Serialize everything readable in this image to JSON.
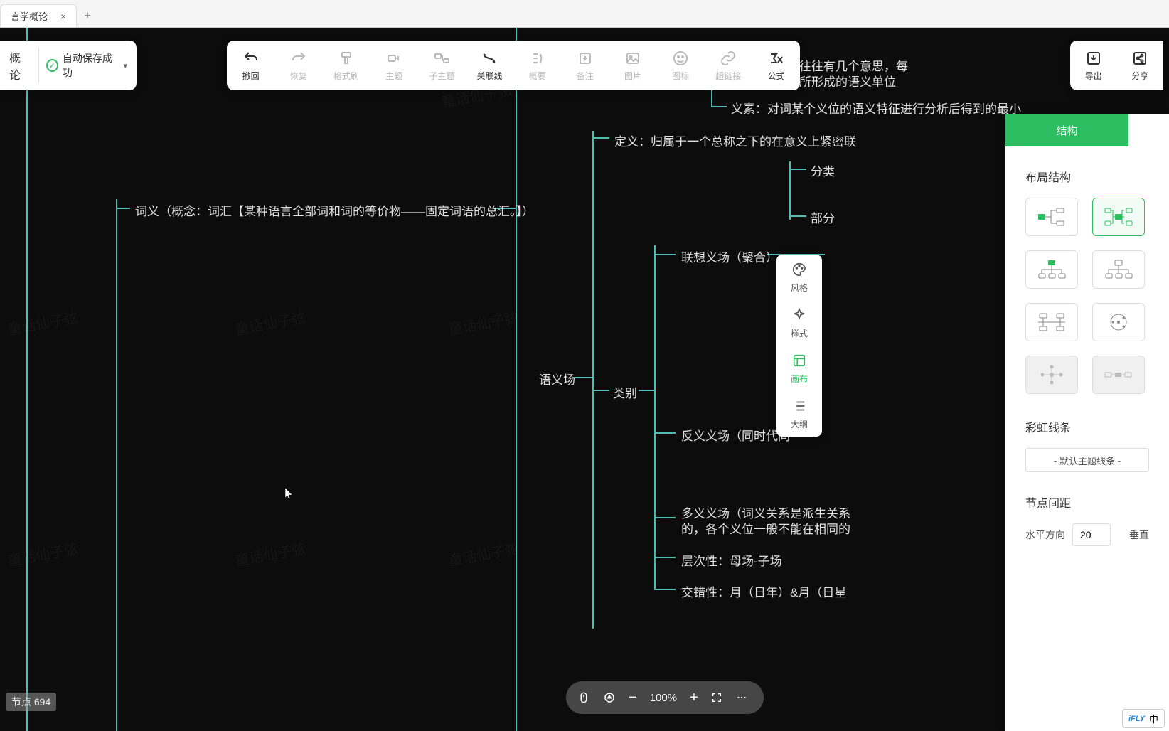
{
  "tab": {
    "title": "言学概论"
  },
  "left_float": {
    "title_cut": "概论",
    "autosave": "自动保存成功"
  },
  "toolbar": [
    {
      "id": "undo",
      "label": "撤回",
      "state": "active"
    },
    {
      "id": "redo",
      "label": "恢复",
      "state": "disabled"
    },
    {
      "id": "format",
      "label": "格式刷",
      "state": "disabled"
    },
    {
      "id": "topic",
      "label": "主题",
      "state": "disabled"
    },
    {
      "id": "subtopic",
      "label": "子主题",
      "state": "disabled"
    },
    {
      "id": "relation",
      "label": "关联线",
      "state": "active"
    },
    {
      "id": "summary",
      "label": "概要",
      "state": "disabled"
    },
    {
      "id": "note",
      "label": "备注",
      "state": "disabled"
    },
    {
      "id": "image",
      "label": "图片",
      "state": "disabled"
    },
    {
      "id": "icon",
      "label": "图标",
      "state": "disabled"
    },
    {
      "id": "link",
      "label": "超链接",
      "state": "disabled"
    },
    {
      "id": "formula",
      "label": "公式",
      "state": "active"
    }
  ],
  "right_toolbar": [
    {
      "id": "export",
      "label": "导出"
    },
    {
      "id": "share",
      "label": "分享"
    }
  ],
  "vtoolbar": [
    {
      "id": "style",
      "label": "风格"
    },
    {
      "id": "format2",
      "label": "样式"
    },
    {
      "id": "canvas",
      "label": "画布",
      "active": true
    },
    {
      "id": "outline",
      "label": "大纲"
    }
  ],
  "nodes": {
    "main": "词义（概念：词汇【某种语言全部词和词的等价物——固定词语的总汇。】）",
    "top_right1": "往往有几个意思，每",
    "top_right2": "所形成的语义单位",
    "yisu": "义素：对词某个义位的语义特征进行分析后得到的最小",
    "dingyi": "定义：归属于一个总称之下的在意义上紧密联",
    "fenlei": "分类",
    "bu": "部分",
    "lianxiang": "联想义场（聚合）",
    "yuyichang": "语义场",
    "leibie": "类别",
    "fanyi": "反义义场（同时代同",
    "duoyi1": "多义义场（词义关系是派生关系",
    "duoyi2": "的，各个义位一般不能在相同的",
    "cengci": "层次性：母场-子场",
    "jiaocuo": "交错性：月（日年）&月（日星"
  },
  "panel": {
    "tab": "结构",
    "layout_heading": "布局结构",
    "rainbow_heading": "彩虹线条",
    "rainbow_value": "- 默认主题线条 -",
    "spacing_heading": "节点间距",
    "h_label": "水平方向",
    "h_value": "20",
    "v_label": "垂直"
  },
  "zoom": {
    "level": "100%"
  },
  "status": {
    "nodes_label": "节点",
    "nodes_count": "694"
  },
  "ime": {
    "logo": "iFLY",
    "lang": "中"
  },
  "watermark": "童话仙子弦"
}
